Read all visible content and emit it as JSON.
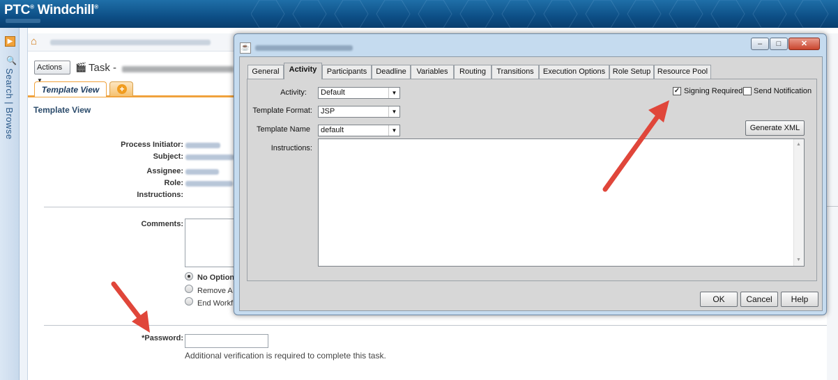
{
  "banner": {
    "brand_ptc": "PTC",
    "brand_reg": "®",
    "brand_product": "Windchill",
    "brand_tm": "®"
  },
  "sidebar": {
    "search_browse": "Search | Browse"
  },
  "task": {
    "actions_label": "Actions",
    "title": "Task -"
  },
  "tabs": {
    "template_view": "Template View"
  },
  "section": {
    "title": "Template View"
  },
  "fields": {
    "process_initiator": "Process Initiator:",
    "subject": "Subject:",
    "assignee": "Assignee:",
    "role": "Role:",
    "instructions": "Instructions:",
    "comments": "Comments:",
    "password": "*Password:",
    "password_note": "Additional verification is required to complete this task."
  },
  "routing_options": [
    {
      "label": "No Option",
      "selected": true
    },
    {
      "label": "Remove A",
      "selected": false
    },
    {
      "label": "End Workf",
      "selected": false
    }
  ],
  "dialog": {
    "tabs": [
      "General",
      "Activity",
      "Participants",
      "Deadline",
      "Variables",
      "Routing",
      "Transitions",
      "Execution Options",
      "Role Setup",
      "Resource Pool"
    ],
    "active_tab": "Activity",
    "activity_label": "Activity:",
    "activity_value": "Default",
    "template_format_label": "Template Format:",
    "template_format_value": "JSP",
    "template_name_label": "Template Name",
    "template_name_value": "default",
    "instructions_label": "Instructions:",
    "signing_required_label": "Signing Required",
    "signing_required_checked": true,
    "send_notification_label": "Send Notification",
    "send_notification_checked": false,
    "generate_xml": "Generate XML",
    "ok": "OK",
    "cancel": "Cancel",
    "help": "Help",
    "minimize_glyph": "–",
    "maximize_glyph": "□",
    "close_glyph": "✕"
  },
  "colors": {
    "arrow": "#e0463a",
    "accent_tab": "#f0a23c",
    "banner": "#0d4f86"
  }
}
